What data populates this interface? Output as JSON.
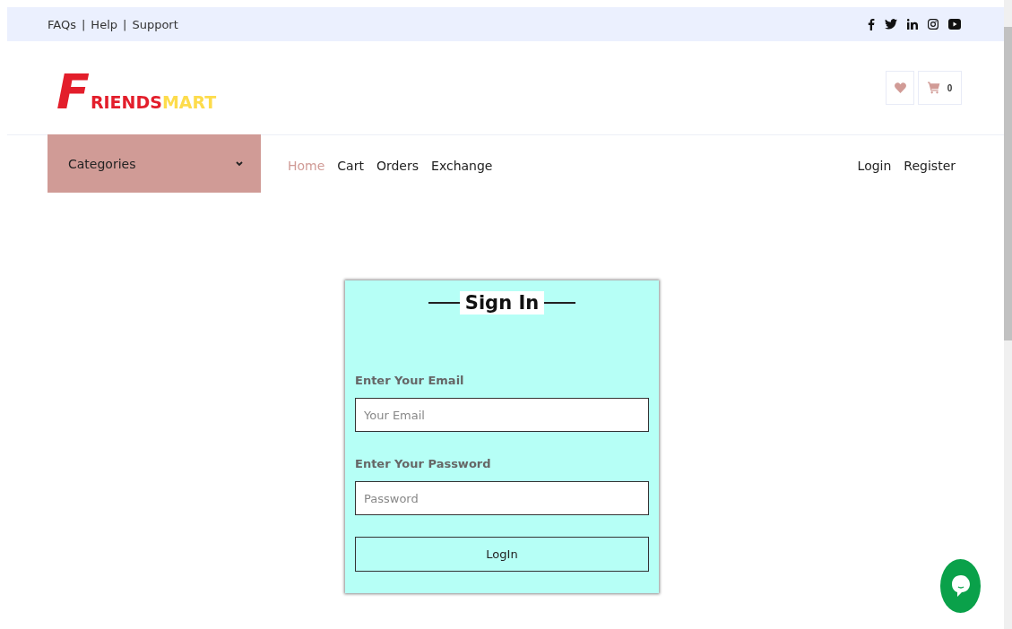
{
  "top_links": [
    "FAQs",
    "Help",
    "Support"
  ],
  "separator": "|",
  "social": [
    {
      "kind": "facebook"
    },
    {
      "kind": "twitter"
    },
    {
      "kind": "linkedin"
    },
    {
      "kind": "instagram"
    },
    {
      "kind": "youtube"
    }
  ],
  "logo": {
    "initial": "F",
    "first": "RIENDS",
    "second": "MART"
  },
  "cart": {
    "count": "0"
  },
  "categories": {
    "label": "Categories"
  },
  "nav": [
    {
      "label": "Home",
      "selected": true
    },
    {
      "label": "Cart",
      "selected": false
    },
    {
      "label": "Orders",
      "selected": false
    },
    {
      "label": "Exchange",
      "selected": false
    }
  ],
  "account_links": [
    "Login",
    "Register"
  ],
  "form": {
    "title": "Sign In",
    "fields": [
      {
        "label": "Enter Your Email",
        "placeholder": "Your Email"
      },
      {
        "label": "Enter Your Password",
        "placeholder": "Password"
      }
    ],
    "submit": "LogIn"
  }
}
